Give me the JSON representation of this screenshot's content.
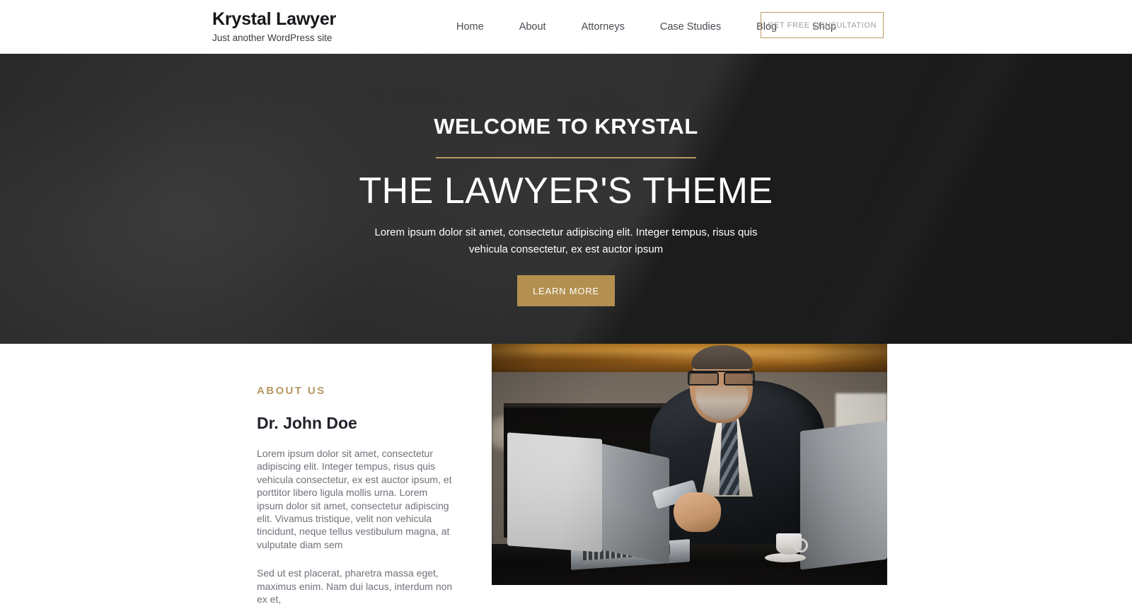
{
  "header": {
    "brand_title": "Krystal Lawyer",
    "brand_tagline": "Just another WordPress site",
    "nav_items": [
      {
        "label": "Home"
      },
      {
        "label": "About"
      },
      {
        "label": "Attorneys"
      },
      {
        "label": "Case Studies"
      },
      {
        "label": "Blog"
      },
      {
        "label": "Shop"
      }
    ],
    "cta_label": "GET FREE CONSULTATION"
  },
  "hero": {
    "eyebrow": "WELCOME TO KRYSTAL",
    "title": "THE LAWYER'S THEME",
    "subtitle": "Lorem ipsum dolor sit amet, consectetur adipiscing elit. Integer tempus, risus quis vehicula consectetur, ex est auctor ipsum",
    "button_label": "LEARN MORE"
  },
  "about": {
    "eyebrow": "ABOUT US",
    "heading": "Dr. John Doe",
    "paragraph_1": "Lorem ipsum dolor sit amet, consectetur adipiscing elit. Integer tempus, risus quis vehicula consectetur, ex est auctor ipsum, et porttitor libero ligula mollis urna. Lorem ipsum dolor sit amet, consectetur adipiscing elit. Vivamus tristique, velit non vehicula tincidunt, neque tellus vestibulum magna, at vulputate diam sem",
    "paragraph_2": "Sed ut est placerat, pharetra massa eget, maximus enim. Nam dui lacus, interdum non ex et,"
  },
  "colors": {
    "gold": "#b79862",
    "gold_button": "#b3904f",
    "hero_overlay": "#262626",
    "heading_dark": "#22222a",
    "body_text": "#70707a"
  }
}
